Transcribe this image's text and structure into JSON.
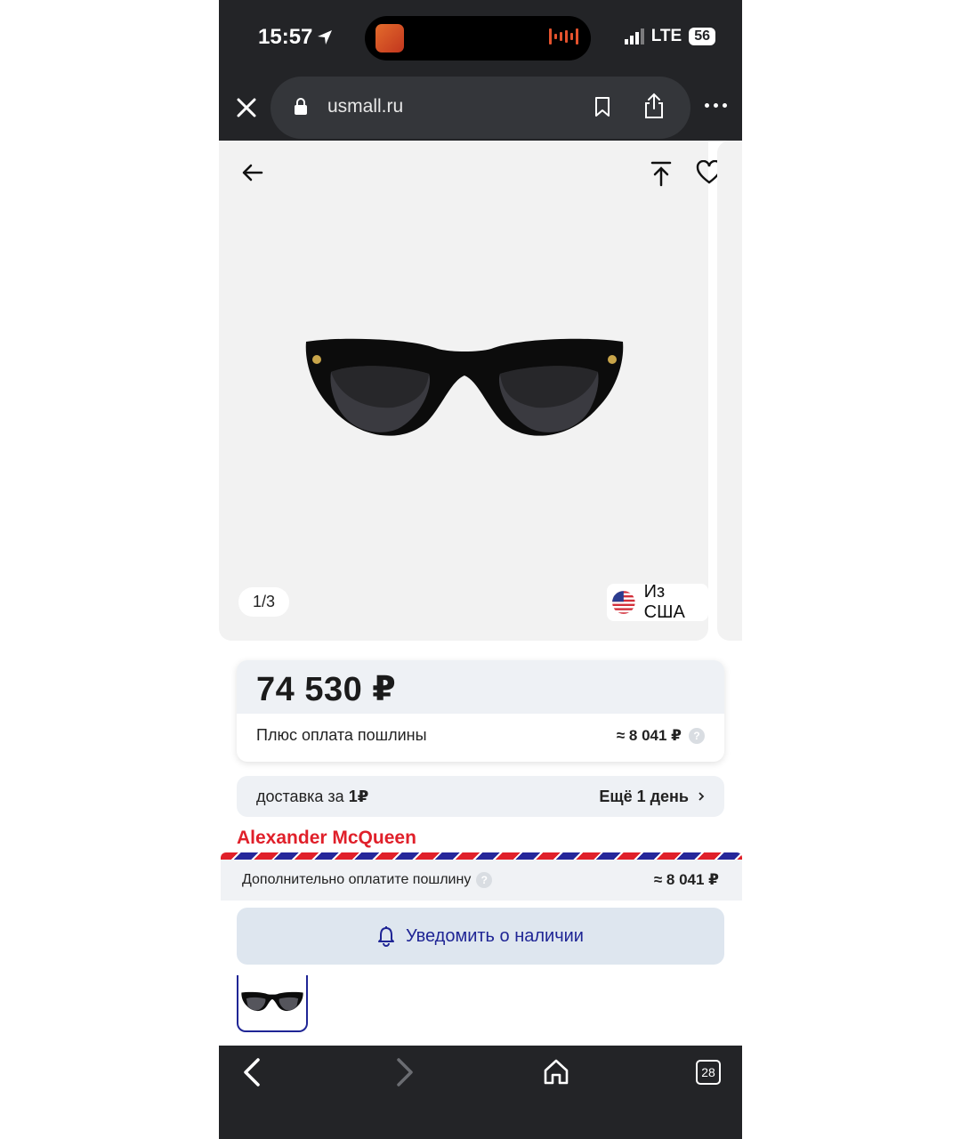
{
  "status_bar": {
    "time": "15:57",
    "network": "LTE",
    "battery": "56"
  },
  "browser": {
    "url": "usmall.ru",
    "tabs_count": "28"
  },
  "gallery": {
    "counter": "1/3",
    "origin": "Из США"
  },
  "price": {
    "value": "74 530 ₽",
    "duty_label": "Плюс оплата пошлины",
    "duty_amount": "≈ 8 041 ₽"
  },
  "delivery": {
    "label_prefix": "доставка за ",
    "price": "1₽",
    "time": "Ещё 1 день"
  },
  "product": {
    "brand": "Alexander McQueen"
  },
  "sticky": {
    "duty_label": "Дополнительно оплатите пошлину",
    "duty_amount": "≈ 8 041 ₽",
    "notify_label": "Уведомить о наличии"
  },
  "colors": {
    "brand": "#e0202a",
    "accent": "#1f2595",
    "bars": "#232427"
  },
  "icons": [
    "close-icon",
    "lock-icon",
    "bookmark-icon",
    "share-icon",
    "more-icon",
    "arrow-left-icon",
    "scroll-top-icon",
    "heart-icon",
    "us-flag-icon",
    "question-icon",
    "chevron-right-icon",
    "bell-icon",
    "back-icon",
    "forward-icon",
    "home-icon",
    "tabs-icon"
  ]
}
